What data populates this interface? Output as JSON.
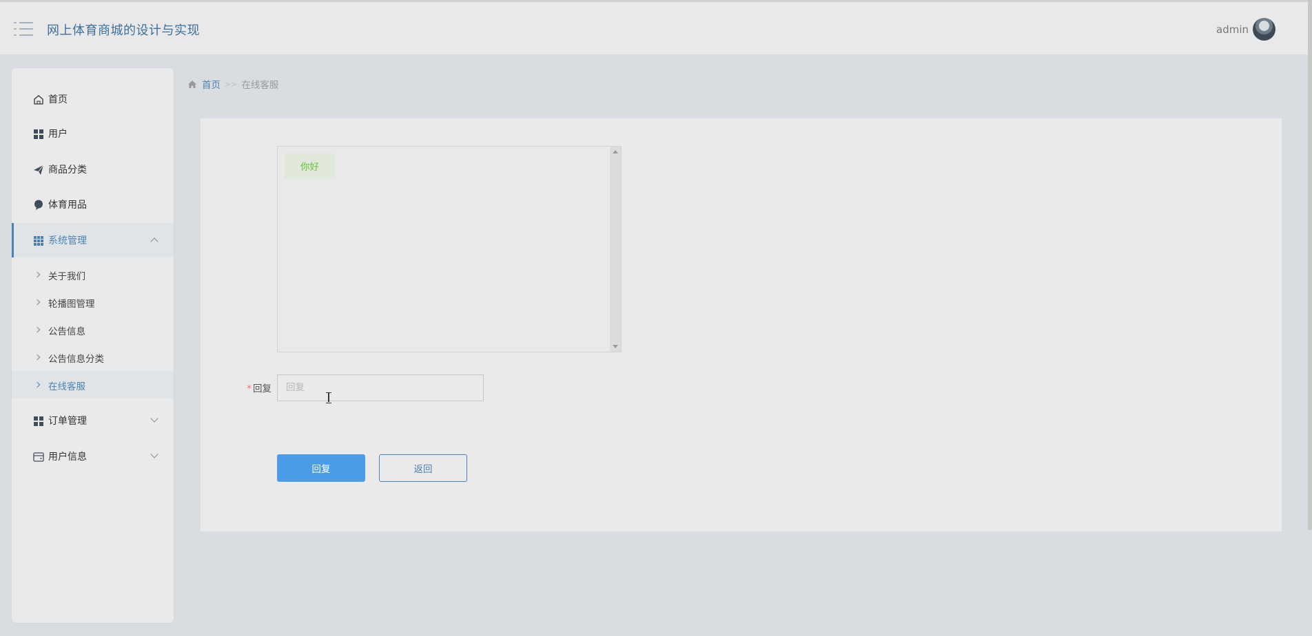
{
  "header": {
    "title": "网上体育商城的设计与实现",
    "username": "admin"
  },
  "sidebar": {
    "items": [
      {
        "label": "首页",
        "icon": "home-icon"
      },
      {
        "label": "用户",
        "icon": "grid-icon"
      },
      {
        "label": "商品分类",
        "icon": "paper-plane-icon"
      },
      {
        "label": "体育用品",
        "icon": "bulb-icon"
      },
      {
        "label": "系统管理",
        "icon": "apps-icon",
        "expanded": true
      },
      {
        "label": "订单管理",
        "icon": "grid-icon"
      },
      {
        "label": "用户信息",
        "icon": "wallet-icon"
      }
    ],
    "sub_items": [
      "关于我们",
      "轮播图管理",
      "公告信息",
      "公告信息分类",
      "在线客服"
    ],
    "active_sub": "在线客服"
  },
  "breadcrumb": {
    "home": "首页",
    "separator": ">>",
    "current": "在线客服"
  },
  "chat": {
    "messages": [
      "你好"
    ]
  },
  "form": {
    "reply_label": "回复",
    "reply_required": "*",
    "reply_placeholder": "回复",
    "reply_value": ""
  },
  "buttons": {
    "submit": "回复",
    "back": "返回"
  },
  "colors": {
    "accent": "#4c82b3",
    "primary_button": "#4a9ce8",
    "message_text": "#67c23a",
    "required": "#f56c6c"
  }
}
